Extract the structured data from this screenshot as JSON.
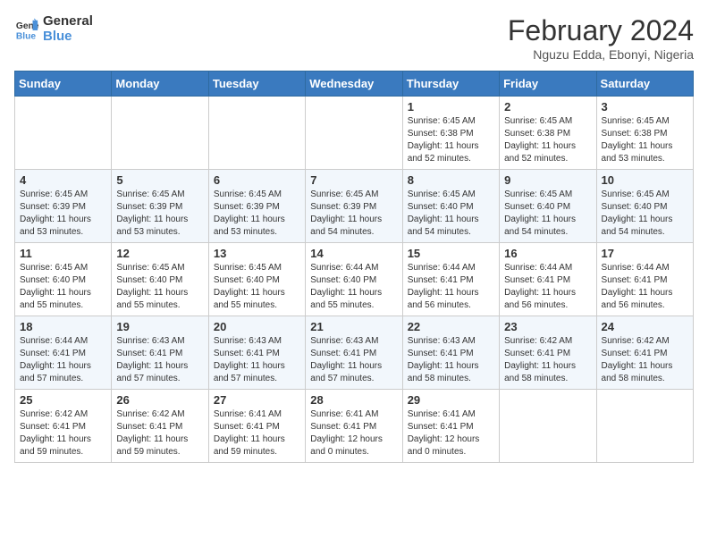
{
  "logo": {
    "line1": "General",
    "line2": "Blue"
  },
  "title": "February 2024",
  "subtitle": "Nguzu Edda, Ebonyi, Nigeria",
  "days_of_week": [
    "Sunday",
    "Monday",
    "Tuesday",
    "Wednesday",
    "Thursday",
    "Friday",
    "Saturday"
  ],
  "weeks": [
    [
      {
        "date": "",
        "info": ""
      },
      {
        "date": "",
        "info": ""
      },
      {
        "date": "",
        "info": ""
      },
      {
        "date": "",
        "info": ""
      },
      {
        "date": "1",
        "info": "Sunrise: 6:45 AM\nSunset: 6:38 PM\nDaylight: 11 hours and 52 minutes."
      },
      {
        "date": "2",
        "info": "Sunrise: 6:45 AM\nSunset: 6:38 PM\nDaylight: 11 hours and 52 minutes."
      },
      {
        "date": "3",
        "info": "Sunrise: 6:45 AM\nSunset: 6:38 PM\nDaylight: 11 hours and 53 minutes."
      }
    ],
    [
      {
        "date": "4",
        "info": "Sunrise: 6:45 AM\nSunset: 6:39 PM\nDaylight: 11 hours and 53 minutes."
      },
      {
        "date": "5",
        "info": "Sunrise: 6:45 AM\nSunset: 6:39 PM\nDaylight: 11 hours and 53 minutes."
      },
      {
        "date": "6",
        "info": "Sunrise: 6:45 AM\nSunset: 6:39 PM\nDaylight: 11 hours and 53 minutes."
      },
      {
        "date": "7",
        "info": "Sunrise: 6:45 AM\nSunset: 6:39 PM\nDaylight: 11 hours and 54 minutes."
      },
      {
        "date": "8",
        "info": "Sunrise: 6:45 AM\nSunset: 6:40 PM\nDaylight: 11 hours and 54 minutes."
      },
      {
        "date": "9",
        "info": "Sunrise: 6:45 AM\nSunset: 6:40 PM\nDaylight: 11 hours and 54 minutes."
      },
      {
        "date": "10",
        "info": "Sunrise: 6:45 AM\nSunset: 6:40 PM\nDaylight: 11 hours and 54 minutes."
      }
    ],
    [
      {
        "date": "11",
        "info": "Sunrise: 6:45 AM\nSunset: 6:40 PM\nDaylight: 11 hours and 55 minutes."
      },
      {
        "date": "12",
        "info": "Sunrise: 6:45 AM\nSunset: 6:40 PM\nDaylight: 11 hours and 55 minutes."
      },
      {
        "date": "13",
        "info": "Sunrise: 6:45 AM\nSunset: 6:40 PM\nDaylight: 11 hours and 55 minutes."
      },
      {
        "date": "14",
        "info": "Sunrise: 6:44 AM\nSunset: 6:40 PM\nDaylight: 11 hours and 55 minutes."
      },
      {
        "date": "15",
        "info": "Sunrise: 6:44 AM\nSunset: 6:41 PM\nDaylight: 11 hours and 56 minutes."
      },
      {
        "date": "16",
        "info": "Sunrise: 6:44 AM\nSunset: 6:41 PM\nDaylight: 11 hours and 56 minutes."
      },
      {
        "date": "17",
        "info": "Sunrise: 6:44 AM\nSunset: 6:41 PM\nDaylight: 11 hours and 56 minutes."
      }
    ],
    [
      {
        "date": "18",
        "info": "Sunrise: 6:44 AM\nSunset: 6:41 PM\nDaylight: 11 hours and 57 minutes."
      },
      {
        "date": "19",
        "info": "Sunrise: 6:43 AM\nSunset: 6:41 PM\nDaylight: 11 hours and 57 minutes."
      },
      {
        "date": "20",
        "info": "Sunrise: 6:43 AM\nSunset: 6:41 PM\nDaylight: 11 hours and 57 minutes."
      },
      {
        "date": "21",
        "info": "Sunrise: 6:43 AM\nSunset: 6:41 PM\nDaylight: 11 hours and 57 minutes."
      },
      {
        "date": "22",
        "info": "Sunrise: 6:43 AM\nSunset: 6:41 PM\nDaylight: 11 hours and 58 minutes."
      },
      {
        "date": "23",
        "info": "Sunrise: 6:42 AM\nSunset: 6:41 PM\nDaylight: 11 hours and 58 minutes."
      },
      {
        "date": "24",
        "info": "Sunrise: 6:42 AM\nSunset: 6:41 PM\nDaylight: 11 hours and 58 minutes."
      }
    ],
    [
      {
        "date": "25",
        "info": "Sunrise: 6:42 AM\nSunset: 6:41 PM\nDaylight: 11 hours and 59 minutes."
      },
      {
        "date": "26",
        "info": "Sunrise: 6:42 AM\nSunset: 6:41 PM\nDaylight: 11 hours and 59 minutes."
      },
      {
        "date": "27",
        "info": "Sunrise: 6:41 AM\nSunset: 6:41 PM\nDaylight: 11 hours and 59 minutes."
      },
      {
        "date": "28",
        "info": "Sunrise: 6:41 AM\nSunset: 6:41 PM\nDaylight: 12 hours and 0 minutes."
      },
      {
        "date": "29",
        "info": "Sunrise: 6:41 AM\nSunset: 6:41 PM\nDaylight: 12 hours and 0 minutes."
      },
      {
        "date": "",
        "info": ""
      },
      {
        "date": "",
        "info": ""
      }
    ]
  ]
}
